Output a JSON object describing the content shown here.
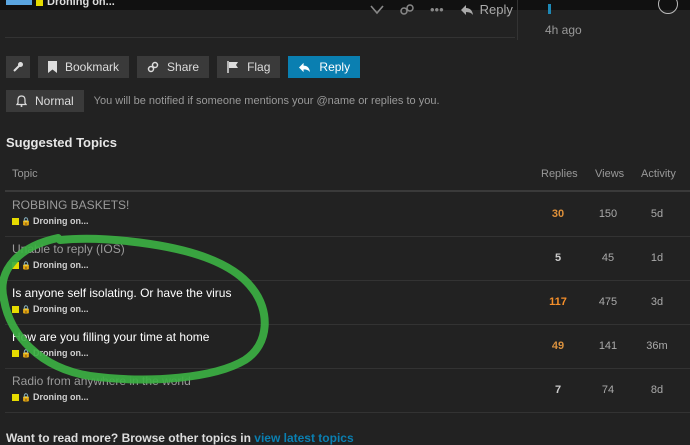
{
  "topbar": {
    "category": "Droning on..."
  },
  "post": {
    "reply_label": "Reply",
    "time": "4h ago"
  },
  "actions": {
    "bookmark": "Bookmark",
    "share": "Share",
    "flag": "Flag",
    "reply": "Reply"
  },
  "notifications": {
    "level": "Normal",
    "description": "You will be notified if someone mentions your @name or replies to you."
  },
  "suggested": {
    "title": "Suggested Topics",
    "headers": {
      "topic": "Topic",
      "replies": "Replies",
      "views": "Views",
      "activity": "Activity"
    },
    "rows": [
      {
        "title": "ROBBING BASKETS!",
        "category": "Droning on...",
        "replies": "30",
        "views": "150",
        "activity": "5d",
        "title_color": "#9a9a9a",
        "replies_color": "#e0913a"
      },
      {
        "title": "Unable to reply (IOS)",
        "category": "Droning on...",
        "replies": "5",
        "views": "45",
        "activity": "1d",
        "title_color": "#9a9a9a",
        "replies_color": "#cccccc"
      },
      {
        "title": "Is anyone self isolating. Or have the virus",
        "category": "Droning on...",
        "replies": "117",
        "views": "475",
        "activity": "3d",
        "title_color": "#ffffff",
        "replies_color": "#f58f2a"
      },
      {
        "title": "How are you filling your time at home",
        "category": "Droning on...",
        "replies": "49",
        "views": "141",
        "activity": "36m",
        "title_color": "#ffffff",
        "replies_color": "#d9913f"
      },
      {
        "title": "Radio from anywhere in the world",
        "category": "Droning on...",
        "replies": "7",
        "views": "74",
        "activity": "8d",
        "title_color": "#9a9a9a",
        "replies_color": "#cccccc"
      }
    ]
  },
  "footer": {
    "text": "Want to read more? Browse other topics in",
    "link": "view latest topics"
  },
  "colors": {
    "accent": "#0a7fb1",
    "category_square": "#e6db00",
    "annotation": "#3cb043"
  }
}
